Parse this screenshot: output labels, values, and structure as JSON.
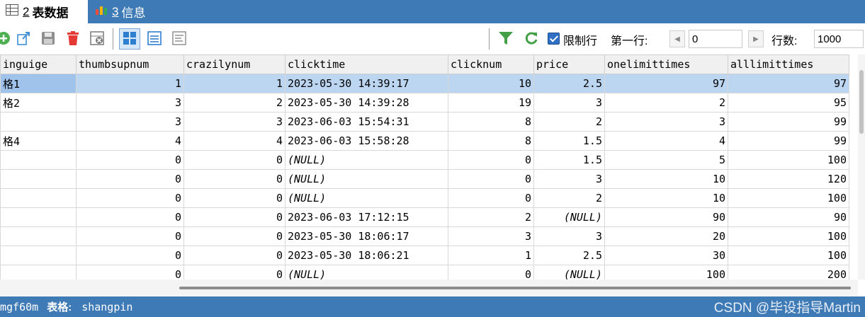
{
  "tabs": [
    {
      "num": "2",
      "label": "表数据",
      "active": true
    },
    {
      "num": "3",
      "label": "信息",
      "active": false
    }
  ],
  "toolbar": {
    "icons": [
      "add-record-icon",
      "export-icon",
      "save-icon",
      "delete-icon",
      "discard-icon",
      "grid-view-icon",
      "form-view-icon",
      "text-view-icon",
      "filter-icon",
      "refresh-icon"
    ],
    "limit_label": "限制行",
    "limit_checked": true,
    "first_row_label": "第一行:",
    "first_row_value": "0",
    "rows_label": "行数:",
    "rows_value": "1000"
  },
  "grid": {
    "columns": [
      "inguige",
      "thumbsupnum",
      "crazilynum",
      "clicktime",
      "clicknum",
      "price",
      "onelimittimes",
      "alllimittimes"
    ],
    "rows": [
      [
        "格1",
        "1",
        "1",
        "2023-05-30 14:39:17",
        "10",
        "2.5",
        "97",
        "97"
      ],
      [
        "格2",
        "3",
        "2",
        "2023-05-30 14:39:28",
        "19",
        "3",
        "2",
        "95"
      ],
      [
        "",
        "3",
        "3",
        "2023-06-03 15:54:31",
        "8",
        "2",
        "3",
        "99"
      ],
      [
        "格4",
        "4",
        "4",
        "2023-06-03 15:58:28",
        "8",
        "1.5",
        "4",
        "99"
      ],
      [
        "",
        "0",
        "0",
        "(NULL)",
        "0",
        "1.5",
        "5",
        "100"
      ],
      [
        "",
        "0",
        "0",
        "(NULL)",
        "0",
        "3",
        "10",
        "120"
      ],
      [
        "",
        "0",
        "0",
        "(NULL)",
        "0",
        "2",
        "10",
        "100"
      ],
      [
        "",
        "0",
        "0",
        "2023-06-03 17:12:15",
        "2",
        "(NULL)",
        "90",
        "90"
      ],
      [
        "",
        "0",
        "0",
        "2023-05-30 18:06:17",
        "3",
        "3",
        "20",
        "100"
      ],
      [
        "",
        "0",
        "0",
        "2023-05-30 18:06:21",
        "1",
        "2.5",
        "30",
        "100"
      ],
      [
        "",
        "0",
        "0",
        "(NULL)",
        "0",
        "(NULL)",
        "100",
        "200"
      ]
    ],
    "selected_row": 0
  },
  "status": {
    "connection": "mgf60m",
    "table_label": "表格:",
    "table_name": "shangpin",
    "watermark": "CSDN @毕设指导Martin"
  },
  "colors": {
    "accent": "#3d7ab6",
    "selected_row": "#bcd6f2"
  }
}
